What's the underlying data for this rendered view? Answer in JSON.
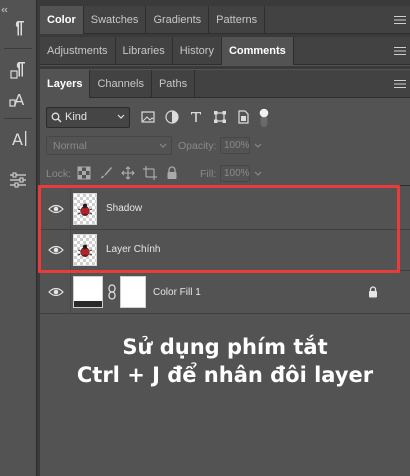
{
  "panel_tabs_row1": [
    {
      "label": "Color",
      "active": true
    },
    {
      "label": "Swatches",
      "active": false
    },
    {
      "label": "Gradients",
      "active": false
    },
    {
      "label": "Patterns",
      "active": false
    }
  ],
  "panel_tabs_row2": [
    {
      "label": "Adjustments",
      "active": false
    },
    {
      "label": "Libraries",
      "active": false
    },
    {
      "label": "History",
      "active": false
    },
    {
      "label": "Comments",
      "active": true
    }
  ],
  "panel_tabs_row3": [
    {
      "label": "Layers",
      "active": true
    },
    {
      "label": "Channels",
      "active": false
    },
    {
      "label": "Paths",
      "active": false
    }
  ],
  "filter": {
    "kind_label": "Kind"
  },
  "blend": {
    "mode": "Normal",
    "opacity_label": "Opacity:",
    "opacity_value": "100%"
  },
  "lock": {
    "label": "Lock:",
    "fill_label": "Fill:",
    "fill_value": "100%"
  },
  "layers": [
    {
      "name": "Shadow",
      "visible": true
    },
    {
      "name": "Layer Chính",
      "visible": true
    },
    {
      "name": "Color Fill 1",
      "visible": true,
      "locked": true
    }
  ],
  "highlight_color": "#e83b3b",
  "caption": {
    "line1": "Sử dụng phím tắt",
    "line2": "Ctrl + J để nhân đôi layer"
  }
}
